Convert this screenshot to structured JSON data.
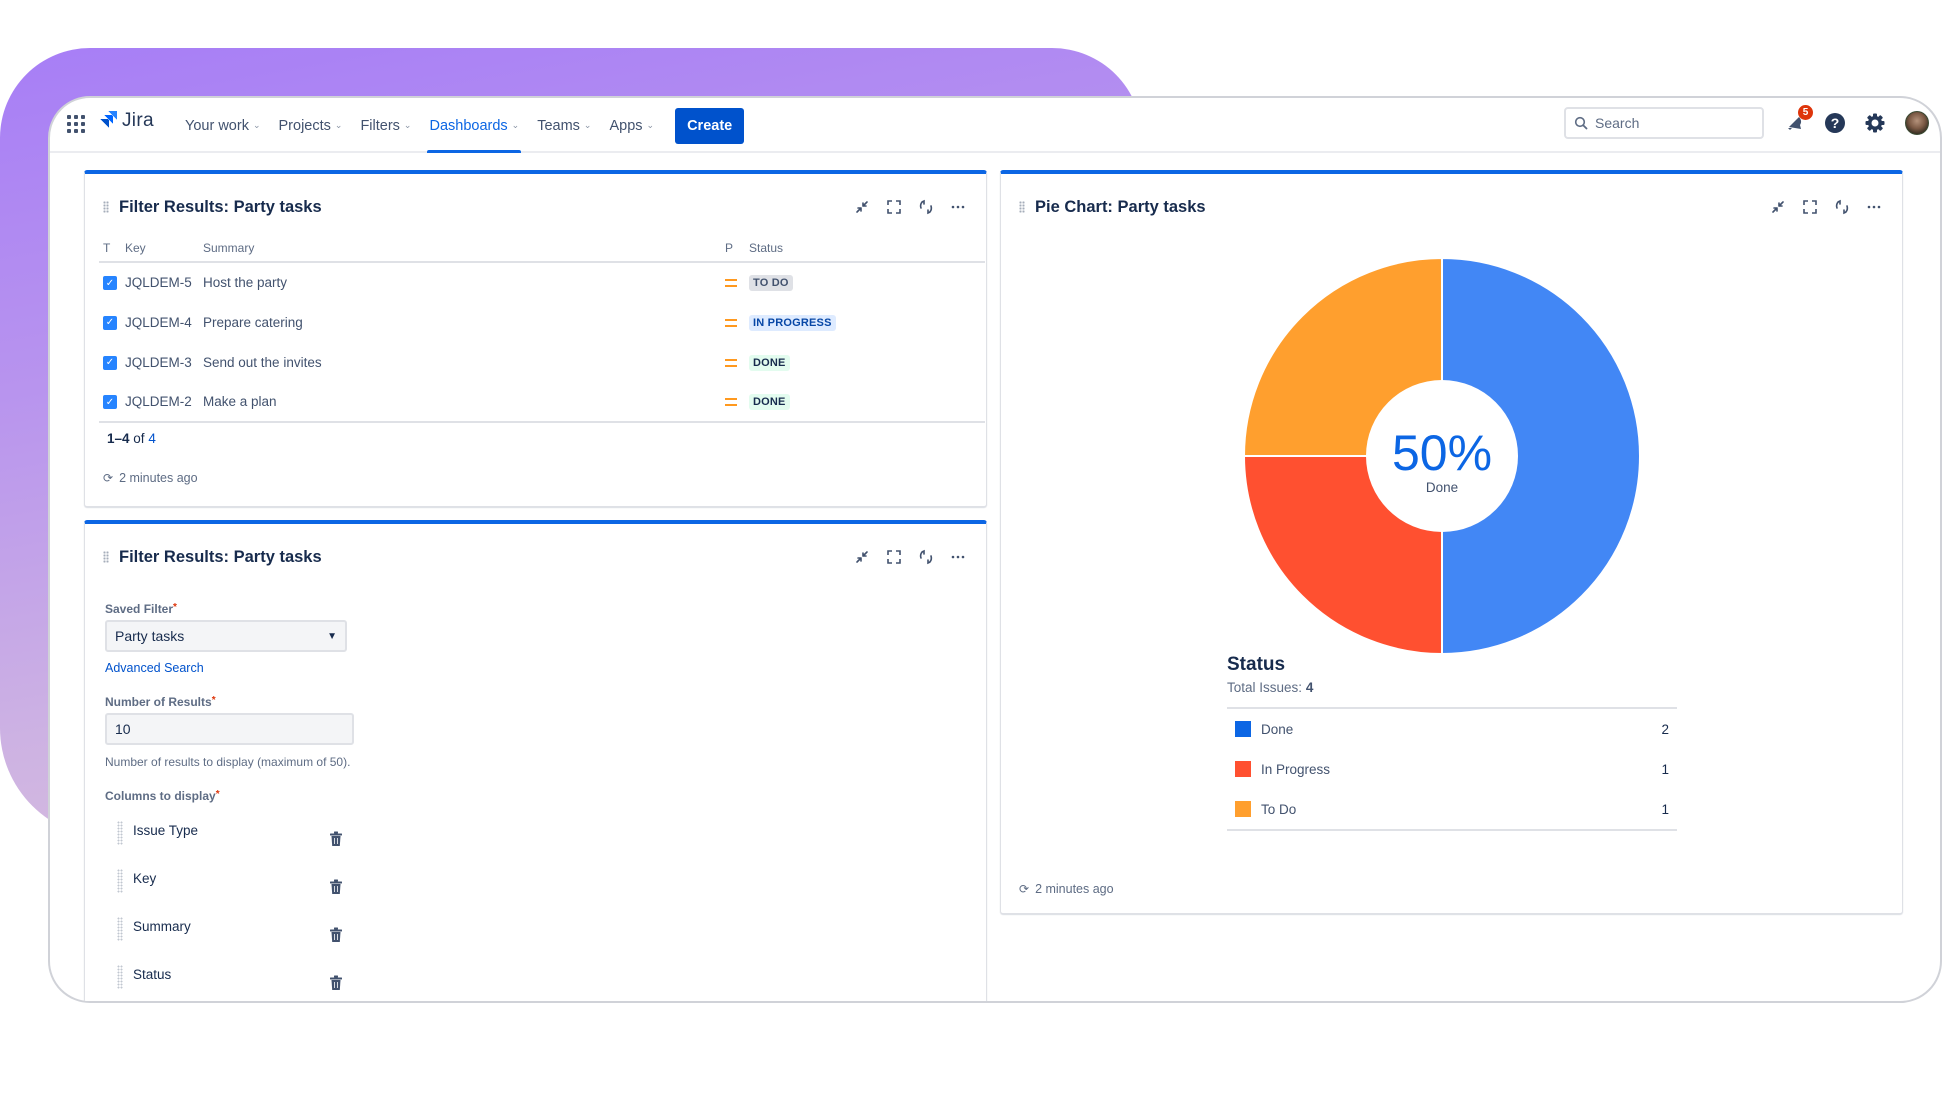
{
  "nav": {
    "app_name": "Jira",
    "items": [
      {
        "label": "Your work",
        "active": false
      },
      {
        "label": "Projects",
        "active": false
      },
      {
        "label": "Filters",
        "active": false
      },
      {
        "label": "Dashboards",
        "active": true
      },
      {
        "label": "Teams",
        "active": false
      },
      {
        "label": "Apps",
        "active": false
      }
    ],
    "create_label": "Create",
    "search_placeholder": "Search",
    "notification_count": "5",
    "icons": [
      "app-switcher-icon",
      "jira-logo-icon",
      "search-icon",
      "notification-icon",
      "help-icon",
      "settings-icon",
      "avatar"
    ]
  },
  "filter_panel": {
    "title": "Filter Results: Party tasks",
    "columns": {
      "t": "T",
      "key": "Key",
      "summary": "Summary",
      "p": "P",
      "status": "Status"
    },
    "rows": [
      {
        "key": "JQLDEM-5",
        "summary": "Host the party",
        "status": "TO DO",
        "status_type": "todo"
      },
      {
        "key": "JQLDEM-4",
        "summary": "Prepare catering",
        "status": "IN PROGRESS",
        "status_type": "progress"
      },
      {
        "key": "JQLDEM-3",
        "summary": "Send out the invites",
        "status": "DONE",
        "status_type": "done"
      },
      {
        "key": "JQLDEM-2",
        "summary": "Make a plan",
        "status": "DONE",
        "status_type": "done"
      }
    ],
    "pager": {
      "range": "1–4",
      "of": "of",
      "total": "4"
    },
    "updated": "2 minutes ago"
  },
  "config_panel": {
    "title": "Filter Results: Party tasks",
    "saved_filter_label": "Saved Filter",
    "saved_filter_value": "Party tasks",
    "advanced_search": "Advanced Search",
    "num_results_label": "Number of Results",
    "num_results_value": "10",
    "num_results_help": "Number of results to display (maximum of 50).",
    "columns_label": "Columns to display",
    "columns": [
      "Issue Type",
      "Key",
      "Summary",
      "Status"
    ],
    "required_mark": "*"
  },
  "pie_panel": {
    "title": "Pie Chart: Party tasks",
    "center_value": "50%",
    "center_label": "Done",
    "legend_title": "Status",
    "total_label": "Total Issues:",
    "total_value": "4",
    "updated": "2 minutes ago"
  },
  "chart_data": {
    "type": "pie",
    "title": "Pie Chart: Party tasks",
    "donut": true,
    "center_text": "50% Done",
    "categories": [
      "Done",
      "In Progress",
      "To Do"
    ],
    "values": [
      2,
      1,
      1
    ],
    "colors": [
      "#4287f5",
      "#ff5030",
      "#ff9f2e"
    ],
    "legend_colors": [
      "#0c66e4",
      "#ff5030",
      "#ff9f2e"
    ],
    "legend_title": "Status",
    "total": 4,
    "legend_position": "bottom"
  }
}
